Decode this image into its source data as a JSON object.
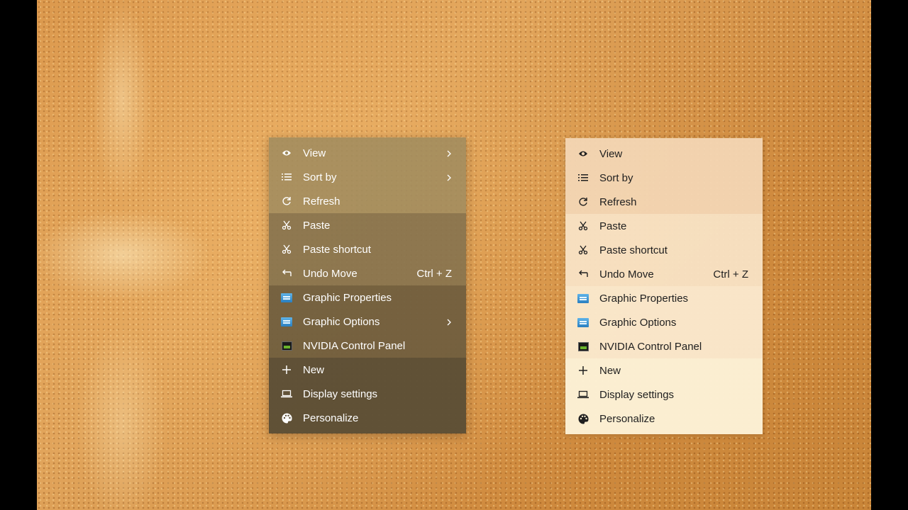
{
  "menus": [
    {
      "theme": "dark",
      "items": [
        {
          "label": "View",
          "icon": "eye-icon",
          "submenu": true
        },
        {
          "label": "Sort by",
          "icon": "list-icon",
          "submenu": true
        },
        {
          "label": "Refresh",
          "icon": "refresh-icon"
        },
        {
          "label": "Paste",
          "icon": "scissors-icon"
        },
        {
          "label": "Paste shortcut",
          "icon": "scissors-icon"
        },
        {
          "label": "Undo Move",
          "icon": "undo-icon",
          "shortcut": "Ctrl + Z"
        },
        {
          "label": "Graphic Properties",
          "icon": "graphics-icon"
        },
        {
          "label": "Graphic Options",
          "icon": "graphics-icon",
          "submenu": true
        },
        {
          "label": "NVIDIA Control Panel",
          "icon": "nvidia-icon"
        },
        {
          "label": "New",
          "icon": "plus-icon"
        },
        {
          "label": "Display settings",
          "icon": "laptop-icon"
        },
        {
          "label": "Personalize",
          "icon": "palette-icon"
        }
      ]
    },
    {
      "theme": "light",
      "items": [
        {
          "label": "View",
          "icon": "eye-icon"
        },
        {
          "label": "Sort by",
          "icon": "list-icon"
        },
        {
          "label": "Refresh",
          "icon": "refresh-icon"
        },
        {
          "label": "Paste",
          "icon": "scissors-icon"
        },
        {
          "label": "Paste shortcut",
          "icon": "scissors-icon"
        },
        {
          "label": "Undo Move",
          "icon": "undo-icon",
          "shortcut": "Ctrl + Z"
        },
        {
          "label": "Graphic Properties",
          "icon": "graphics-icon"
        },
        {
          "label": "Graphic Options",
          "icon": "graphics-icon"
        },
        {
          "label": "NVIDIA Control Panel",
          "icon": "nvidia-icon"
        },
        {
          "label": "New",
          "icon": "plus-icon"
        },
        {
          "label": "Display settings",
          "icon": "laptop-icon"
        },
        {
          "label": "Personalize",
          "icon": "palette-icon"
        }
      ]
    }
  ],
  "colors": {
    "dark_text": "#ffffff",
    "light_text": "#1f1f1f",
    "wallpaper": "#d9954a"
  }
}
